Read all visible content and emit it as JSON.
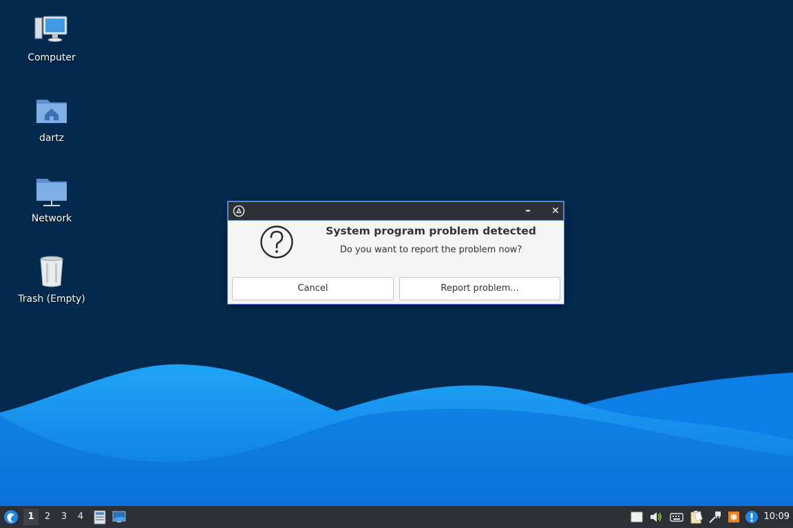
{
  "desktop": {
    "icons": [
      {
        "label": "Computer",
        "icon": "computer-icon"
      },
      {
        "label": "dartz",
        "icon": "home-folder-icon"
      },
      {
        "label": "Network",
        "icon": "network-folder-icon"
      },
      {
        "label": "Trash (Empty)",
        "icon": "trash-icon"
      }
    ]
  },
  "dialog": {
    "title_icon": "app-crash-icon",
    "minimize_glyph": "–",
    "close_glyph": "✕",
    "icon": "question-icon",
    "headline": "System program problem detected",
    "message": "Do you want to report the problem now?",
    "cancel_label": "Cancel",
    "report_label": "Report problem..."
  },
  "taskbar": {
    "workspaces": [
      "1",
      "2",
      "3",
      "4"
    ],
    "active_workspace": "1",
    "tray_icons": [
      "notes-icon",
      "volume-icon",
      "keyboard-icon",
      "clipboard-icon",
      "network-icon",
      "update-icon",
      "alert-icon"
    ],
    "clock": "10:09"
  },
  "colors": {
    "desktop_bg": "#022a4e",
    "wave_light": "#1a9af0",
    "wave_dark": "#0d6fdc",
    "taskbar_bg": "#2c2f33",
    "dialog_border": "#4a8ad6"
  }
}
